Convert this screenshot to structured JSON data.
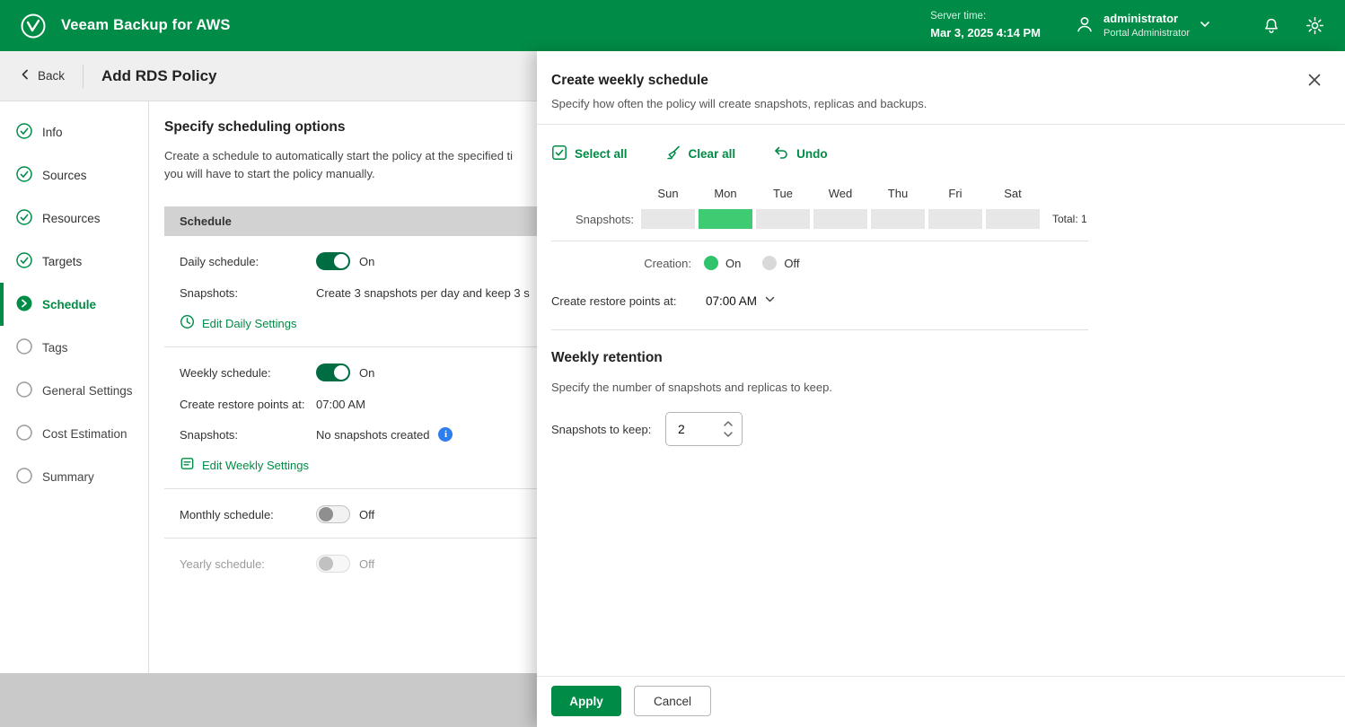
{
  "colors": {
    "header_green": "#008c46",
    "accent_green": "#008c46",
    "bright_green": "#3ecb71",
    "toggle_on_green": "#006c42",
    "info_blue": "#2d7ff0"
  },
  "header": {
    "app_title": "Veeam Backup for AWS",
    "server_time_label": "Server time:",
    "server_time_value": "Mar 3, 2025 4:14 PM",
    "user_name": "administrator",
    "user_role": "Portal Administrator"
  },
  "breadcrumb": {
    "back_label": "Back",
    "page_title": "Add RDS Policy"
  },
  "steps": [
    {
      "label": "Info",
      "state": "done"
    },
    {
      "label": "Sources",
      "state": "done"
    },
    {
      "label": "Resources",
      "state": "done"
    },
    {
      "label": "Targets",
      "state": "done"
    },
    {
      "label": "Schedule",
      "state": "current"
    },
    {
      "label": "Tags",
      "state": "todo"
    },
    {
      "label": "General Settings",
      "state": "todo"
    },
    {
      "label": "Cost Estimation",
      "state": "todo"
    },
    {
      "label": "Summary",
      "state": "todo"
    }
  ],
  "main": {
    "heading": "Specify scheduling options",
    "description_line1": "Create a schedule to automatically start the policy at the specified ti",
    "description_line2": "you will have to start the policy manually.",
    "table_header": "Schedule",
    "rows": {
      "daily_label": "Daily schedule:",
      "daily_state": "On",
      "daily_snapshots_label": "Snapshots:",
      "daily_snapshots_value": "Create 3 snapshots per day and keep 3 s",
      "edit_daily": "Edit Daily Settings",
      "weekly_label": "Weekly schedule:",
      "weekly_state": "On",
      "weekly_restore_label": "Create restore points at:",
      "weekly_restore_value": "07:00 AM",
      "weekly_snapshots_label": "Snapshots:",
      "weekly_snapshots_value": "No snapshots created",
      "edit_weekly": "Edit Weekly Settings",
      "monthly_label": "Monthly schedule:",
      "monthly_state": "Off",
      "yearly_label": "Yearly schedule:",
      "yearly_state": "Off"
    }
  },
  "panel": {
    "title": "Create weekly schedule",
    "subtitle": "Specify how often the policy will create snapshots, replicas and backups.",
    "toolbar": {
      "select_all": "Select all",
      "clear_all": "Clear all",
      "undo": "Undo"
    },
    "days": [
      "Sun",
      "Mon",
      "Tue",
      "Wed",
      "Thu",
      "Fri",
      "Sat"
    ],
    "snapshots_row_label": "Snapshots:",
    "selected_days": [
      "Mon"
    ],
    "total_label": "Total: 1",
    "creation_label": "Creation:",
    "creation_on": "On",
    "creation_off": "Off",
    "creation_value": "On",
    "restore_label": "Create restore points at:",
    "restore_value": "07:00 AM",
    "retention_heading": "Weekly retention",
    "retention_description": "Specify the number of snapshots and replicas to keep.",
    "keep_label": "Snapshots to keep:",
    "keep_value": "2",
    "apply_label": "Apply",
    "cancel_label": "Cancel"
  }
}
